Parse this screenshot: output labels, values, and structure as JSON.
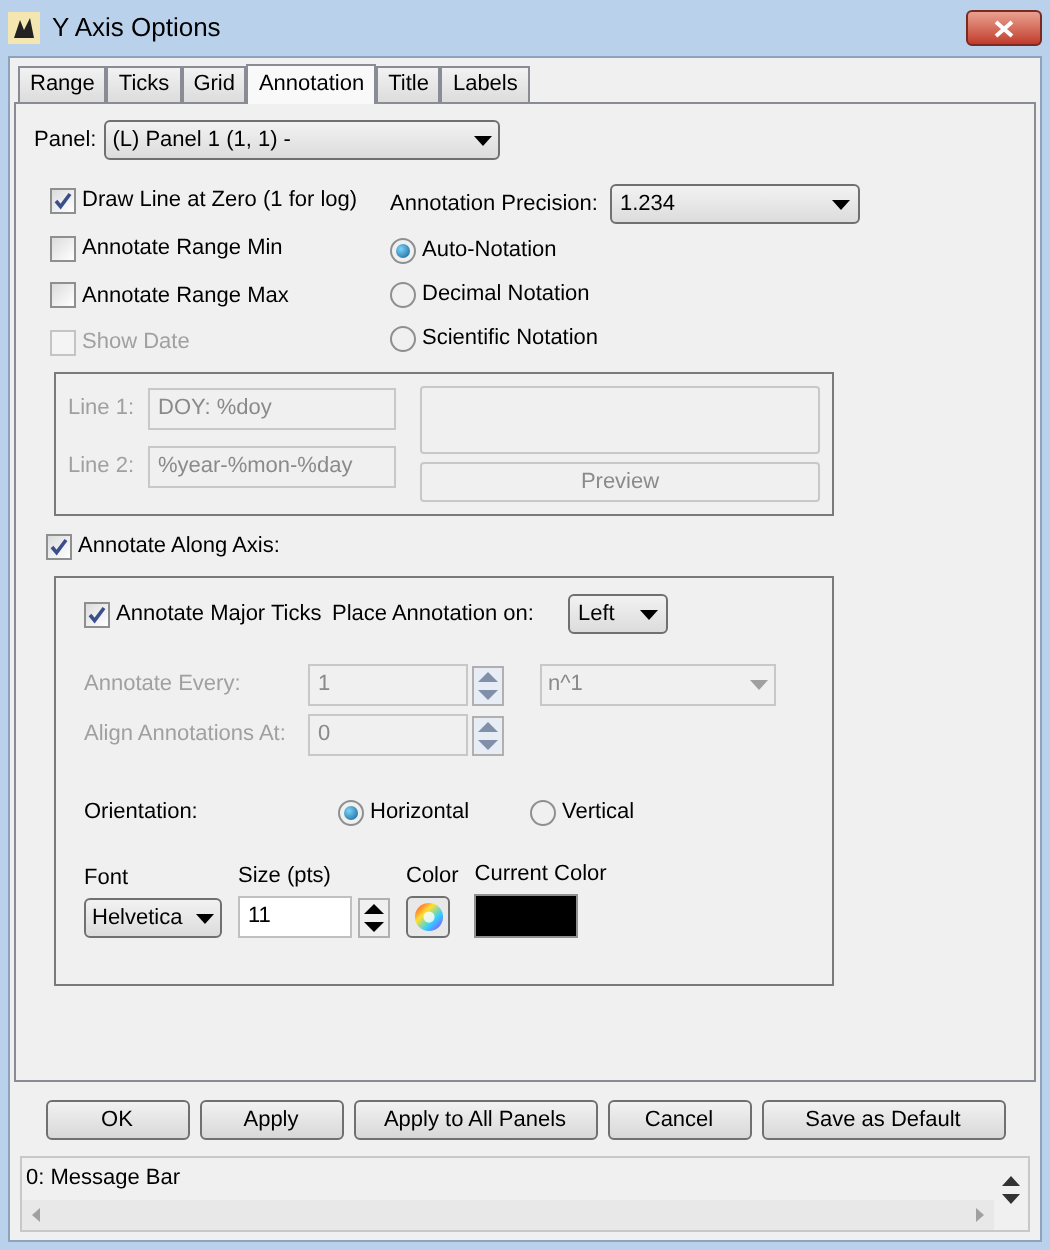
{
  "window": {
    "title": "Y Axis Options"
  },
  "tabs": [
    {
      "label": "Range",
      "selected": false
    },
    {
      "label": "Ticks",
      "selected": false
    },
    {
      "label": "Grid",
      "selected": false
    },
    {
      "label": "Annotation",
      "selected": true
    },
    {
      "label": "Title",
      "selected": false
    },
    {
      "label": "Labels",
      "selected": false
    }
  ],
  "panel": {
    "label": "Panel:",
    "value": "(L)  Panel 1 (1, 1)  -"
  },
  "options": [
    {
      "label": "Draw Line at Zero (1 for log)",
      "checked": true,
      "disabled": false
    },
    {
      "label": "Annotate Range Min",
      "checked": false,
      "disabled": false
    },
    {
      "label": "Annotate Range Max",
      "checked": false,
      "disabled": false
    },
    {
      "label": "Show Date",
      "checked": false,
      "disabled": true
    }
  ],
  "precision": {
    "label": "Annotation Precision:",
    "value": "1.234"
  },
  "notation": [
    {
      "label": "Auto-Notation",
      "selected": true
    },
    {
      "label": "Decimal Notation",
      "selected": false
    },
    {
      "label": "Scientific Notation",
      "selected": false
    }
  ],
  "date_format": {
    "disabled": true,
    "lines": [
      {
        "label": "Line 1:",
        "value": "DOY: %doy"
      },
      {
        "label": "Line 2:",
        "value": "%year-%mon-%day"
      }
    ],
    "preview_button": "Preview"
  },
  "annotate_along_axis": {
    "label": "Annotate Along Axis:",
    "checked": true
  },
  "axis": {
    "major_ticks": {
      "label": "Annotate Major Ticks",
      "checked": true
    },
    "place": {
      "label": "Place Annotation on:",
      "value": "Left"
    },
    "annotate_every": {
      "label": "Annotate Every:",
      "value": "1",
      "unit": "n^1",
      "disabled": true
    },
    "align": {
      "label": "Align Annotations At:",
      "value": "0",
      "disabled": true
    },
    "orientation": {
      "label": "Orientation:",
      "options": [
        {
          "label": "Horizontal",
          "selected": true
        },
        {
          "label": "Vertical",
          "selected": false
        }
      ]
    },
    "font": {
      "label": "Font",
      "value": "Helvetica"
    },
    "size": {
      "label": "Size (pts)",
      "value": "11"
    },
    "color": {
      "label": "Color"
    },
    "current_color": {
      "label": "Current Color",
      "color": "#000000"
    }
  },
  "buttons": [
    "OK",
    "Apply",
    "Apply to All Panels",
    "Cancel",
    "Save as Default"
  ],
  "message_bar": "0: Message Bar"
}
